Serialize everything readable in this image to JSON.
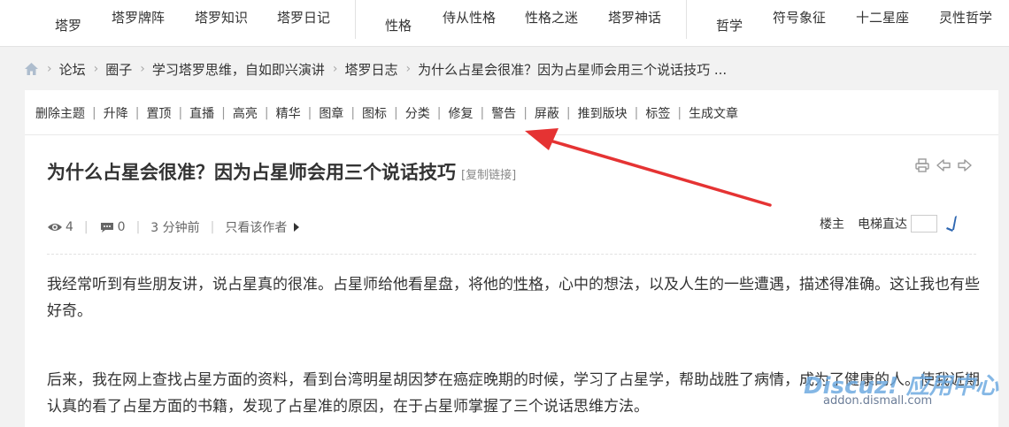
{
  "nav": {
    "groups": [
      {
        "main": "塔罗",
        "subs": [
          "塔罗牌阵",
          "塔罗知识",
          "塔罗日记"
        ]
      },
      {
        "main": "性格",
        "subs": [
          "侍从性格",
          "性格之迷",
          "塔罗神话"
        ]
      },
      {
        "main": "哲学",
        "subs": [
          "符号象征",
          "十二星座",
          "灵性哲学"
        ]
      }
    ]
  },
  "breadcrumb": {
    "items": [
      "论坛",
      "圈子",
      "学习塔罗思维，自如即兴演讲",
      "塔罗日志",
      "为什么占星会很准？因为占星师会用三个说话技巧 ..."
    ],
    "separator": "›"
  },
  "admin_actions": [
    "删除主题",
    "升降",
    "置顶",
    "直播",
    "高亮",
    "精华",
    "图章",
    "图标",
    "分类",
    "修复",
    "警告",
    "屏蔽",
    "推到版块",
    "标签",
    "生成文章"
  ],
  "post": {
    "title": "为什么占星会很准？因为占星师会用三个说话技巧",
    "copy_link": "[复制链接]",
    "views": "4",
    "replies": "0",
    "time": "3 分钟前",
    "author_only": "只看该作者",
    "floor_owner": "楼主",
    "elevator_label": "电梯直达",
    "paragraph1": {
      "before": "我经常听到有些朋友讲，说占星真的很准。占星师给他看星盘，将他的",
      "link": "性格",
      "after": "，心中的想法，以及人生的一些遭遇，描述得准确。这让我也有些好奇。"
    },
    "paragraph2": "后来，我在网上查找占星方面的资料，看到台湾明星胡因梦在癌症晚期的时候，学习了占星学，帮助战胜了病情，成为了健康的人。使我近期认真的看了占星方面的书籍，发现了占星准的原因，在于占星师掌握了三个说话思维方法。"
  },
  "watermark": {
    "brand": "Discuz! 应用中心",
    "url": "addon.dismall.com"
  },
  "colors": {
    "arrow": "#e53333",
    "background": "#f2f2f2",
    "panel": "#ffffff",
    "text": "#333333",
    "muted": "#888888"
  },
  "icons": [
    "home-icon",
    "eye-icon",
    "comment-icon",
    "print-icon",
    "prev-icon",
    "next-icon",
    "go-icon"
  ]
}
